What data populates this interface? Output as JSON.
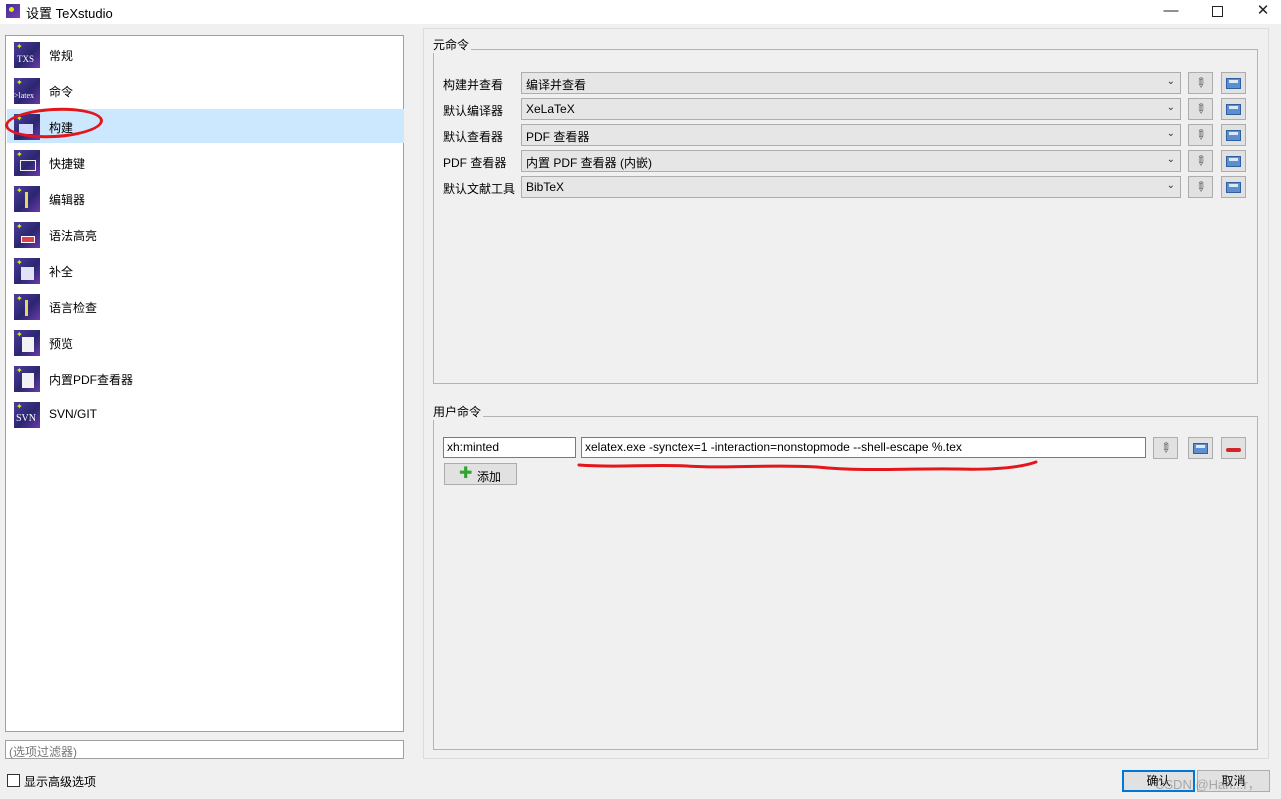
{
  "window": {
    "title": "设置 TeXstudio"
  },
  "categories": [
    {
      "label": "常规",
      "icon": "txs-icon",
      "glyph": "TXS"
    },
    {
      "label": "命令",
      "icon": "latex-command-icon",
      "glyph": ">latex"
    },
    {
      "label": "构建",
      "icon": "build-icon",
      "glyph": ""
    },
    {
      "label": "快捷键",
      "icon": "keyboard-icon",
      "glyph": ""
    },
    {
      "label": "编辑器",
      "icon": "editor-cursor-icon",
      "glyph": ""
    },
    {
      "label": "语法高亮",
      "icon": "syntax-highlight-icon",
      "glyph": ""
    },
    {
      "label": "补全",
      "icon": "completion-icon",
      "glyph": ""
    },
    {
      "label": "语言检查",
      "icon": "language-check-icon",
      "glyph": ""
    },
    {
      "label": "预览",
      "icon": "preview-icon",
      "glyph": ""
    },
    {
      "label": "内置PDF查看器",
      "icon": "pdf-viewer-icon",
      "glyph": ""
    },
    {
      "label": "SVN/GIT",
      "icon": "svn-icon",
      "glyph": "SVN"
    }
  ],
  "selected_category": "构建",
  "filter": {
    "placeholder": "(选项过滤器)"
  },
  "advanced_options": {
    "label": "显示高级选项",
    "checked": false
  },
  "meta_commands": {
    "title": "元命令",
    "rows": [
      {
        "label": "构建并查看",
        "value": "编译并查看"
      },
      {
        "label": "默认编译器",
        "value": "XeLaTeX"
      },
      {
        "label": "默认查看器",
        "value": "PDF 查看器"
      },
      {
        "label": "PDF 查看器",
        "value": "内置 PDF 查看器 (内嵌)"
      },
      {
        "label": "默认文献工具",
        "value": "BibTeX"
      }
    ]
  },
  "user_commands": {
    "title": "用户命令",
    "name_value": "xh:minted",
    "command_value": "xelatex.exe -synctex=1 -interaction=nonstopmode --shell-escape %.tex",
    "add_label": "添加"
  },
  "buttons": {
    "ok": "确认",
    "cancel": "取消"
  },
  "watermark": "CSDN @Han...r，",
  "colors": {
    "selection": "#cce8ff",
    "annotation_red": "#e3161b",
    "focus_blue": "#0078d7"
  }
}
